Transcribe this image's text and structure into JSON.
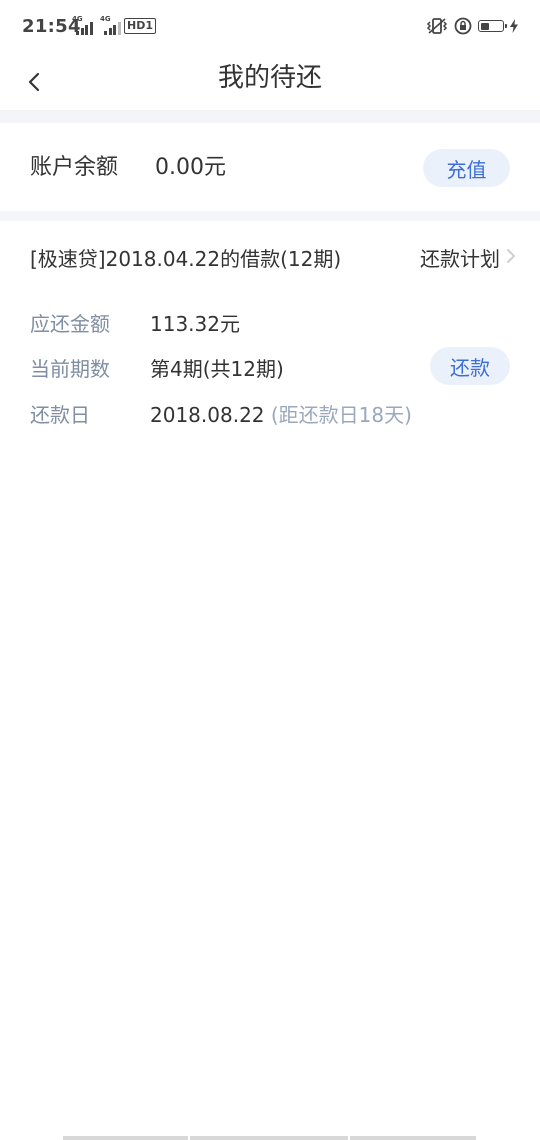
{
  "status_bar": {
    "time": "21:54",
    "sim1_label": "4G",
    "sim2_label": "4G",
    "hd_label": "HD1",
    "battery_level": 0.4
  },
  "nav": {
    "title": "我的待还",
    "back_icon": "chevron-left-icon"
  },
  "balance": {
    "label": "账户余额",
    "value": "0.00元",
    "button": "充值"
  },
  "loan": {
    "title": "[极速贷]2018.04.22的借款(12期)",
    "plan_link": "还款计划",
    "amount_label": "应还金额",
    "amount_value": "113.32元",
    "period_label": "当前期数",
    "period_value": "第4期(共12期)",
    "repay_button": "还款",
    "due_label": "还款日",
    "due_date": "2018.08.22",
    "due_hint": "(距还款日18天)"
  },
  "colors": {
    "accent": "#3d6ed6",
    "pill_bg": "#ebf1fb",
    "label_gray": "#7f8ea3",
    "separator": "#f3f5f8"
  }
}
